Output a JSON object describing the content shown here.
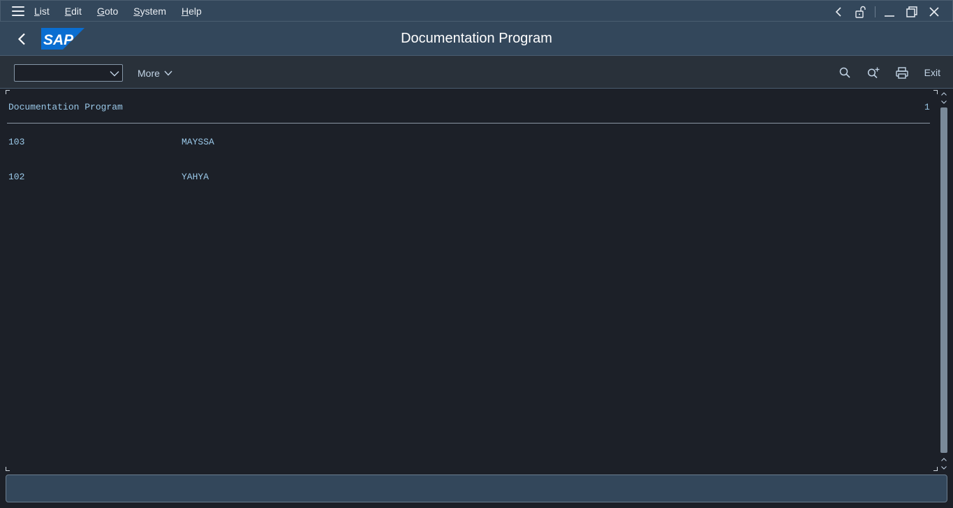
{
  "menu": {
    "items": [
      "List",
      "Edit",
      "Goto",
      "System",
      "Help"
    ]
  },
  "title_bar": {
    "title": "Documentation Program",
    "logo_text": "SAP"
  },
  "toolbar": {
    "command_value": "",
    "more_label": "More",
    "exit_label": "Exit",
    "icons": [
      "search-icon",
      "search-next-icon",
      "print-icon"
    ]
  },
  "list": {
    "header_title": "Documentation Program",
    "page_number": "1",
    "rows": [
      {
        "id": "103",
        "name": "MAYSSA"
      },
      {
        "id": "102",
        "name": "YAHYA"
      }
    ]
  },
  "colors": {
    "shell_bg": "#33475b",
    "content_bg": "#1c2028",
    "list_text": "#9ac8e8",
    "sap_blue": "#0a6ed1"
  }
}
